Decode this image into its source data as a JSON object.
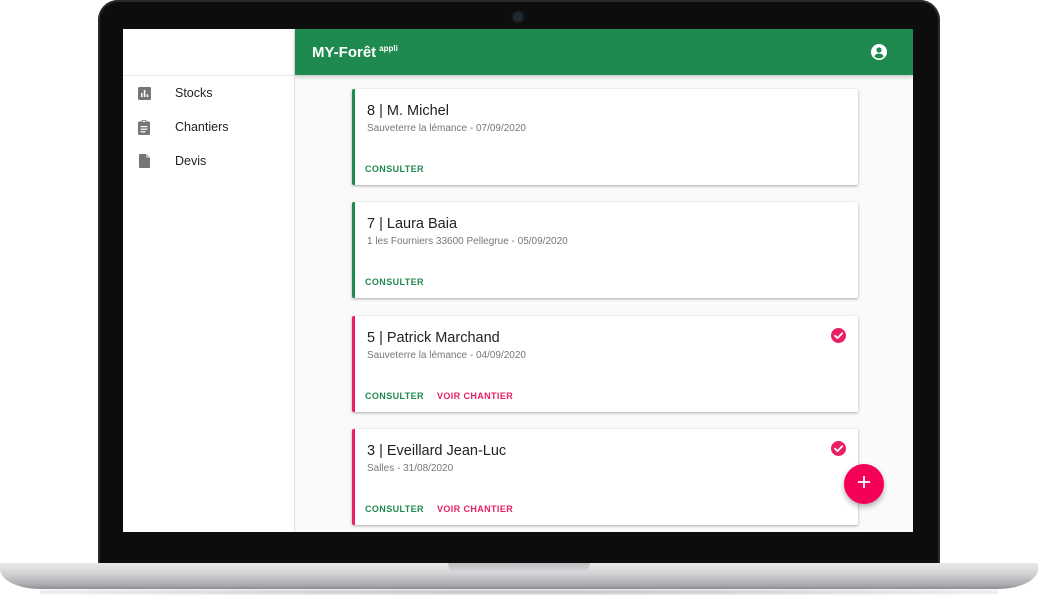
{
  "app": {
    "title": "MY-Forêt",
    "title_sup": "appli"
  },
  "sidebar": {
    "items": [
      {
        "label": "Stocks",
        "icon": "bar-chart-icon"
      },
      {
        "label": "Chantiers",
        "icon": "clipboard-icon"
      },
      {
        "label": "Devis",
        "icon": "document-icon"
      }
    ]
  },
  "colors": {
    "primary": "#1f8a50",
    "accent": "#e91e63",
    "fab": "#f50057"
  },
  "cards": [
    {
      "title": "8 | M. Michel",
      "subtitle": "Sauveterre la lémance - 07/09/2020",
      "consult_label": "CONSULTER",
      "done": false
    },
    {
      "title": "7 | Laura Baia",
      "subtitle": "1 les Fourniers 33600 Pellegrue - 05/09/2020",
      "consult_label": "CONSULTER",
      "done": false
    },
    {
      "title": "5 | Patrick Marchand",
      "subtitle": "Sauveterre la lémance - 04/09/2020",
      "consult_label": "CONSULTER",
      "voir_label": "VOIR CHANTIER",
      "done": true
    },
    {
      "title": "3 | Eveillard Jean-Luc",
      "subtitle": "Salles - 31/08/2020",
      "consult_label": "CONSULTER",
      "voir_label": "VOIR CHANTIER",
      "done": true
    }
  ]
}
